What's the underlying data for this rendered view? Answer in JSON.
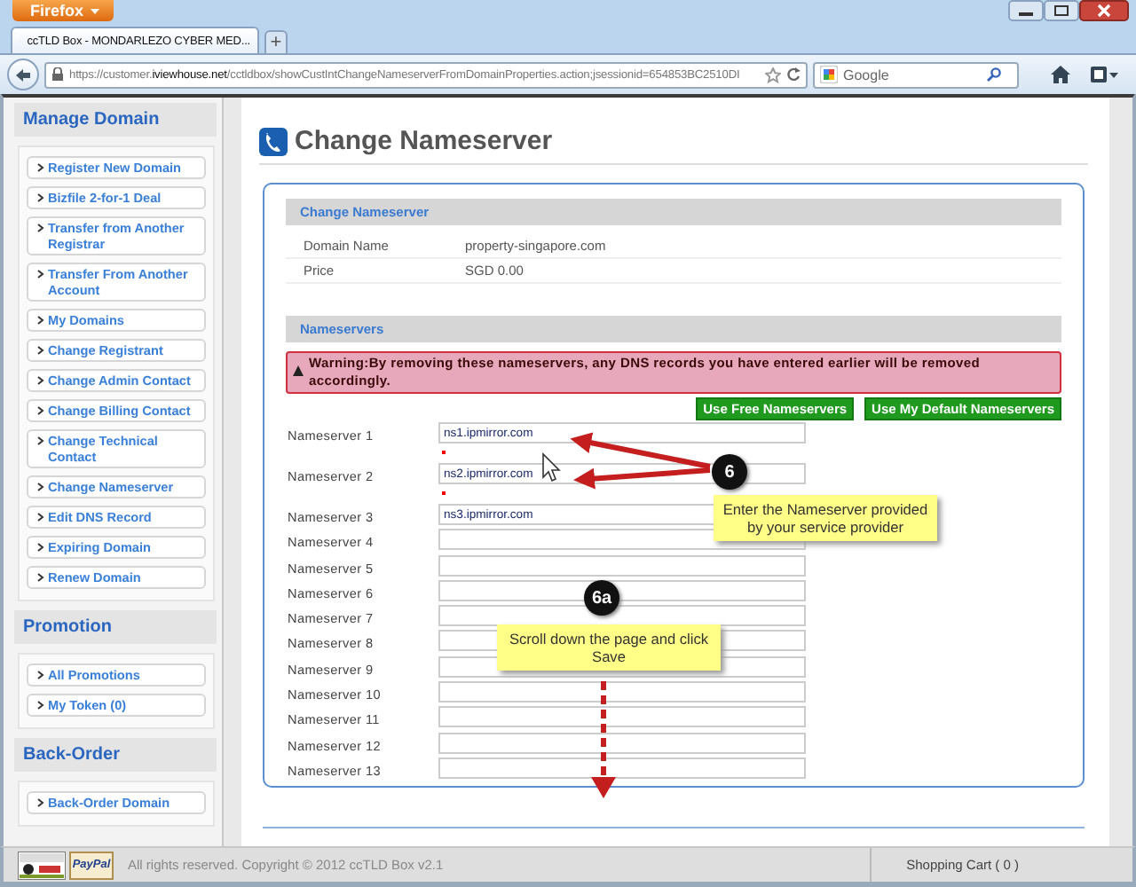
{
  "browser": {
    "menu_button": "Firefox",
    "tab_title": "ccTLD Box - MONDARLEZO CYBER MED...",
    "new_tab": "+",
    "url": "https://customer.**iviewhouse.net**/cctldbox/showCustIntChangeNameserverFromDomainProperties.action;jsessionid=654853BC2510DI",
    "search_placeholder": "Google"
  },
  "sidebar": {
    "sections": [
      {
        "title": "Manage Domain",
        "items": [
          "Register New Domain",
          "Bizfile 2-for-1 Deal",
          "Transfer from Another Registrar",
          "Transfer From Another Account",
          "My Domains",
          "Change Registrant",
          "Change Admin Contact",
          "Change Billing Contact",
          "Change Technical Contact",
          "Change Nameserver",
          "Edit DNS Record",
          "Expiring Domain",
          "Renew Domain"
        ]
      },
      {
        "title": "Promotion",
        "items": [
          "All Promotions",
          "My Token (0)"
        ]
      },
      {
        "title": "Back-Order",
        "items": [
          "Back-Order Domain"
        ]
      }
    ]
  },
  "page": {
    "title": "Change Nameserver",
    "details": {
      "header": "Change Nameserver",
      "fields": [
        {
          "label": "Domain Name",
          "value": "property-singapore.com"
        },
        {
          "label": "Price",
          "value": "SGD 0.00"
        }
      ]
    },
    "nameservers": {
      "header": "Nameservers",
      "warning": "Warning:By removing these nameservers, any DNS records you have entered earlier will be removed accordingly.",
      "buttons": [
        "Use Free Nameservers",
        "Use My Default Nameservers"
      ],
      "rows": [
        {
          "label": "Nameserver 1",
          "value": "ns1.ipmirror.com",
          "required": true
        },
        {
          "label": "Nameserver 2",
          "value": "ns2.ipmirror.com",
          "required": true
        },
        {
          "label": "Nameserver 3",
          "value": "ns3.ipmirror.com",
          "required": false
        },
        {
          "label": "Nameserver 4",
          "required": false
        },
        {
          "label": "Nameserver 5",
          "required": false
        },
        {
          "label": "Nameserver 6",
          "required": false
        },
        {
          "label": "Nameserver 7",
          "required": false
        },
        {
          "label": "Nameserver 8",
          "required": false
        },
        {
          "label": "Nameserver 9",
          "required": false
        },
        {
          "label": "Nameserver 10",
          "required": false
        },
        {
          "label": "Nameserver 11",
          "required": false
        },
        {
          "label": "Nameserver 12",
          "required": false
        },
        {
          "label": "Nameserver 13",
          "required": false
        }
      ]
    }
  },
  "annotations": [
    {
      "kind": "step",
      "text": "6"
    },
    {
      "kind": "note",
      "text": "Enter the Nameserver provided by your service provider"
    },
    {
      "kind": "step",
      "text": "6a"
    },
    {
      "kind": "note",
      "text": "Scroll down the page and click Save"
    }
  ],
  "footer": {
    "paypal_badge": "PayPal",
    "copyright": "All rights reserved. Copyright © 2012 ccTLD Box v2.1",
    "cart": "Shopping Cart ( 0 )"
  }
}
